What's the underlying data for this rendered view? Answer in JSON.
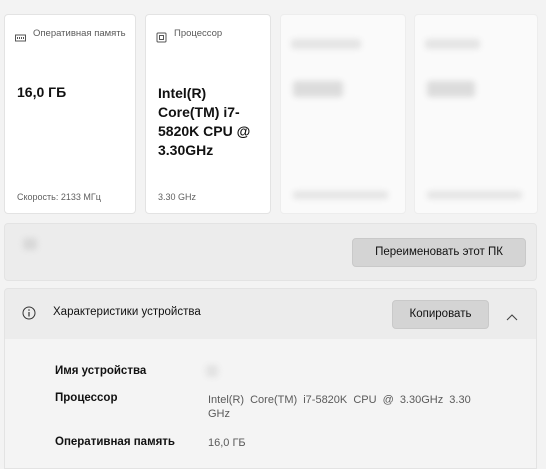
{
  "cards": [
    {
      "icon": "memory-icon",
      "title": "Оперативная память",
      "value": "16,0 ГБ",
      "footer": "Скорость: 2133 МГц"
    },
    {
      "icon": "processor-icon",
      "title": "Процессор",
      "value": "Intel(R) Core(TM) i7-5820K CPU @ 3.30GHz",
      "footer": "3.30 GHz"
    }
  ],
  "rename_button_label": "Переименовать этот ПК",
  "specs": {
    "title": "Характеристики устройства",
    "copy_label": "Копировать",
    "rows": [
      {
        "label": "Имя устройства",
        "value": ""
      },
      {
        "label": "Процессор",
        "value": "Intel(R) Core(TM) i7-5820K CPU @ 3.30GHz 3.30 GHz"
      },
      {
        "label": "Оперативная память",
        "value": "16,0 ГБ"
      }
    ]
  }
}
